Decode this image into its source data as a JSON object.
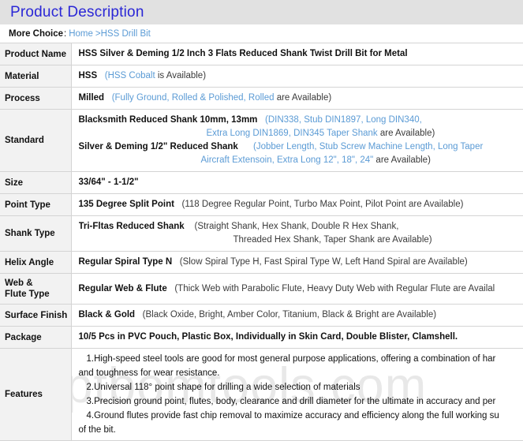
{
  "header": {
    "title": "Product Description"
  },
  "breadcrumb": {
    "label": "More Choice",
    "separator": ":",
    "home": "Home",
    "gt": ">",
    "current": "HSS Drill Bit"
  },
  "table": {
    "rows": [
      {
        "label": "Product Name",
        "lines": [
          {
            "bold": "HSS Silver & Deming 1/2 Inch 3 Flats Reduced Shank Twist Drill Bit for Metal"
          }
        ]
      },
      {
        "label": "Material",
        "lines": [
          {
            "bold": "HSS",
            "blue": "(HSS Cobalt",
            "tail": " is Available)"
          }
        ]
      },
      {
        "label": "Process",
        "lines": [
          {
            "bold": "Milled",
            "blue": "(Fully Ground, Rolled & Polished, Rolled",
            "tail": " are Available)"
          }
        ]
      },
      {
        "label": "Standard",
        "lines": [
          {
            "bold": "Blacksmith Reduced Shank 10mm, 13mm",
            "blue": "(DIN338, Stub DIN1897, Long DIN340,"
          },
          {
            "blue_only": "Extra Long DIN1869, DIN345 Taper Shank",
            "tail": " are Available)"
          },
          {
            "bold": "Silver & Deming 1/2\" Reduced Shank",
            "blue": "(Jobber Length, Stub Screw Machine Length, Long Taper"
          },
          {
            "blue_only": "Aircraft Extensoin, Extra Long 12\", 18\", 24\"",
            "tail": " are Available)"
          }
        ]
      },
      {
        "label": "Size",
        "lines": [
          {
            "bold": "33/64\" - 1-1/2\""
          }
        ]
      },
      {
        "label": "Point Type",
        "lines": [
          {
            "bold": "135 Degree Split Point",
            "muted": "(118 Degree Regular Point, Turbo Max Point, Pilot Point are Available)"
          }
        ]
      },
      {
        "label": "Shank Type",
        "lines": [
          {
            "bold": "Tri-Fltas Reduced Shank",
            "muted": "(Straight Shank, Hex Shank, Double R Hex Shank,"
          },
          {
            "muted_only": "Threaded Hex Shank, Taper Shank are Available)"
          }
        ]
      },
      {
        "label": "Helix Angle",
        "lines": [
          {
            "bold": "Regular Spiral Type N",
            "muted": "(Slow Spiral Type H, Fast Spiral Type W, Left Hand Spiral are Available)"
          }
        ]
      },
      {
        "label": "Web &\nFlute Type",
        "label_line1": "Web &",
        "label_line2": "Flute Type",
        "lines": [
          {
            "bold": "Regular Web & Flute",
            "muted": "(Thick Web with Parabolic Flute, Heavy Duty Web with Regular Flute are Availal"
          }
        ]
      },
      {
        "label": "Surface Finish",
        "lines": [
          {
            "bold": "Black & Gold",
            "muted": "(Black Oxide, Bright, Amber Color, Titanium, Black & Bright are Available)"
          }
        ]
      },
      {
        "label": "Package",
        "lines": [
          {
            "bold": "10/5 Pcs in PVC Pouch, Plastic Box, Individually in Skin Card, Double Blister, Clamshell."
          }
        ]
      }
    ],
    "features": {
      "label": "Features",
      "lines": [
        "1.High-speed steel tools are good for most general purpose applications, offering a combination of har",
        "and toughness for wear resistance.",
        "2.Universal 118° point shape for drilling a wide selection of materials",
        "3.Precision ground point, flutes, body, clearance and drill diameter for the ultimate in accuracy and per",
        "4.Ground flutes provide fast chip removal to maximize accuracy and efficiency along the full working su",
        "of the bit."
      ],
      "watermark": "ptbomtools.com"
    }
  },
  "colors": {
    "header_band": "#e1e1e1",
    "header_title": "#2a26d6",
    "link_blue": "#5b9bd5",
    "label_bg": "#f2f2f2",
    "border": "#d4d4d4",
    "text": "#111111"
  }
}
